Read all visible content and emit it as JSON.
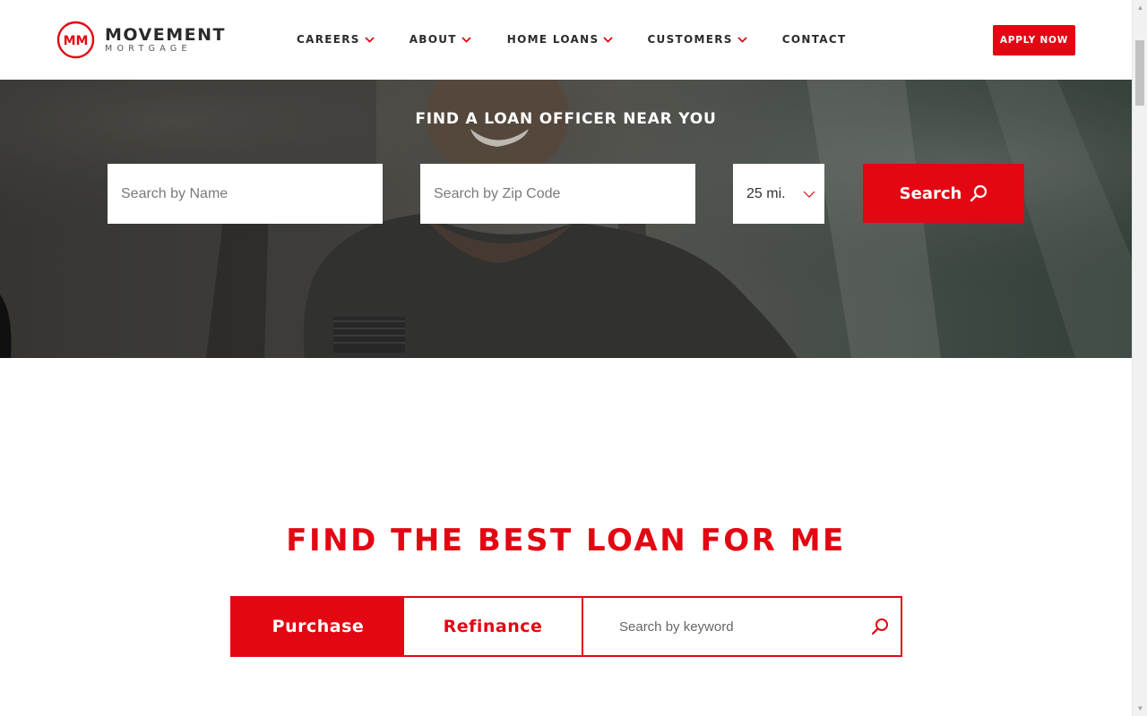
{
  "colors": {
    "brand_red": "#e30613",
    "nav_text": "#2b2b2b",
    "white": "#ffffff"
  },
  "header": {
    "logo": {
      "monogram": "MM",
      "name": "MOVEMENT",
      "sub": "MORTGAGE"
    },
    "nav": [
      {
        "label": "CAREERS",
        "has_dropdown": true
      },
      {
        "label": "ABOUT",
        "has_dropdown": true
      },
      {
        "label": "HOME LOANS",
        "has_dropdown": true
      },
      {
        "label": "CUSTOMERS",
        "has_dropdown": true
      },
      {
        "label": "CONTACT",
        "has_dropdown": false
      }
    ],
    "apply_label": "APPLY NOW"
  },
  "hero": {
    "title": "FIND A LOAN OFFICER NEAR YOU",
    "name_placeholder": "Search by Name",
    "zip_placeholder": "Search by Zip Code",
    "radius_value": "25 mi.",
    "search_label": "Search",
    "icons": {
      "search": "search-icon",
      "dropdown": "chevron-down-icon"
    }
  },
  "loan_finder": {
    "title": "FIND THE BEST LOAN FOR ME",
    "tabs": [
      {
        "label": "Purchase",
        "active": true
      },
      {
        "label": "Refinance",
        "active": false
      }
    ],
    "keyword_placeholder": "Search by keyword"
  }
}
